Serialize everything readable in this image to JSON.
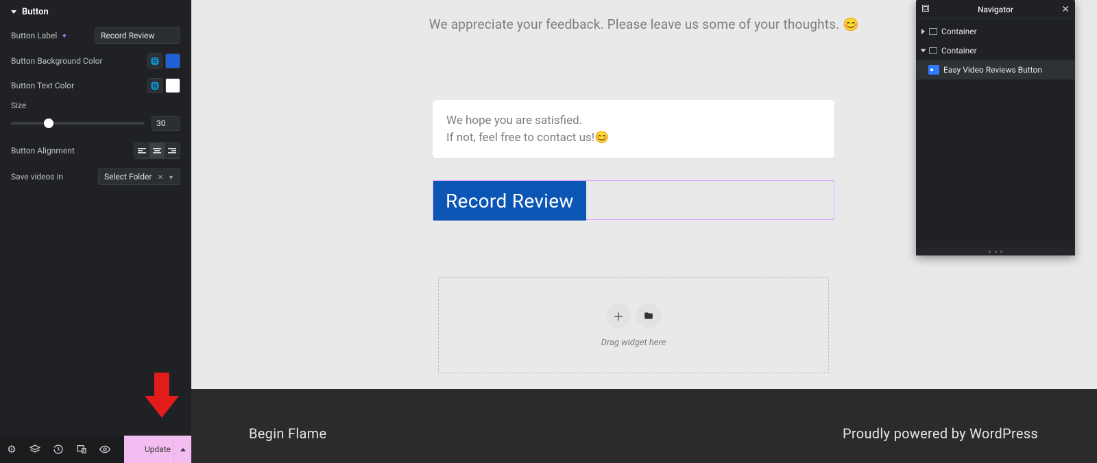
{
  "sidebar": {
    "section_title": "Button",
    "button_label_label": "Button Label",
    "button_label_value": "Record Review",
    "bg_color_label": "Button Background Color",
    "bg_color_value": "#1e60d6",
    "text_color_label": "Button Text Color",
    "text_color_value": "#ffffff",
    "size_label": "Size",
    "size_value": "30",
    "size_percent": 28,
    "alignment_label": "Button Alignment",
    "save_videos_label": "Save videos in",
    "folder_placeholder": "Select Folder",
    "update_label": "Update"
  },
  "canvas": {
    "intro": "We appreciate your feedback. Please leave us some of your thoughts. 😊",
    "card_line1": "We hope you are satisfied.",
    "card_line2": "If not, feel free to contact us!😊",
    "record_button": "Record Review",
    "drag_text": "Drag widget here",
    "site_name": "Begin Flame",
    "powered": "Proudly powered by WordPress"
  },
  "navigator": {
    "title": "Navigator",
    "items": [
      {
        "label": "Container",
        "expanded": false,
        "depth": 0
      },
      {
        "label": "Container",
        "expanded": true,
        "depth": 0
      },
      {
        "label": "Easy Video Reviews Button",
        "depth": 1,
        "selected": true
      }
    ]
  }
}
